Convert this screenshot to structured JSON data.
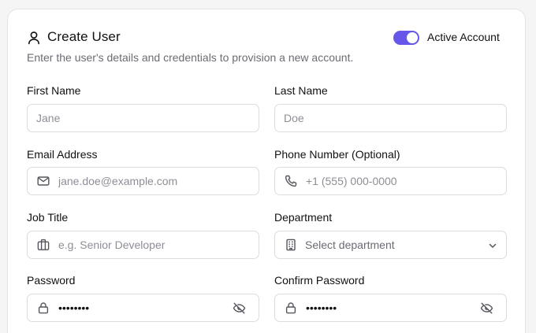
{
  "header": {
    "title": "Create User",
    "subtitle": "Enter the user's details and credentials to provision a new account.",
    "icon": "user-icon"
  },
  "active_toggle": {
    "label": "Active Account",
    "checked": true,
    "accent": "#6657e8"
  },
  "fields": {
    "first_name": {
      "label": "First Name",
      "placeholder": "Jane"
    },
    "last_name": {
      "label": "Last Name",
      "placeholder": "Doe"
    },
    "email": {
      "label": "Email Address",
      "placeholder": "jane.doe@example.com",
      "icon": "mail-icon"
    },
    "phone": {
      "label": "Phone Number (Optional)",
      "placeholder": "+1 (555) 000-0000",
      "icon": "phone-icon"
    },
    "job_title": {
      "label": "Job Title",
      "placeholder": "e.g. Senior Developer",
      "icon": "briefcase-icon"
    },
    "department": {
      "label": "Department",
      "placeholder": "Select department",
      "icon": "building-icon"
    },
    "password": {
      "label": "Password",
      "value": "password",
      "icon": "lock-icon",
      "trailing_icon": "eye-off-icon"
    },
    "confirm_password": {
      "label": "Confirm Password",
      "value": "password",
      "icon": "lock-icon",
      "trailing_icon": "eye-off-icon"
    }
  }
}
